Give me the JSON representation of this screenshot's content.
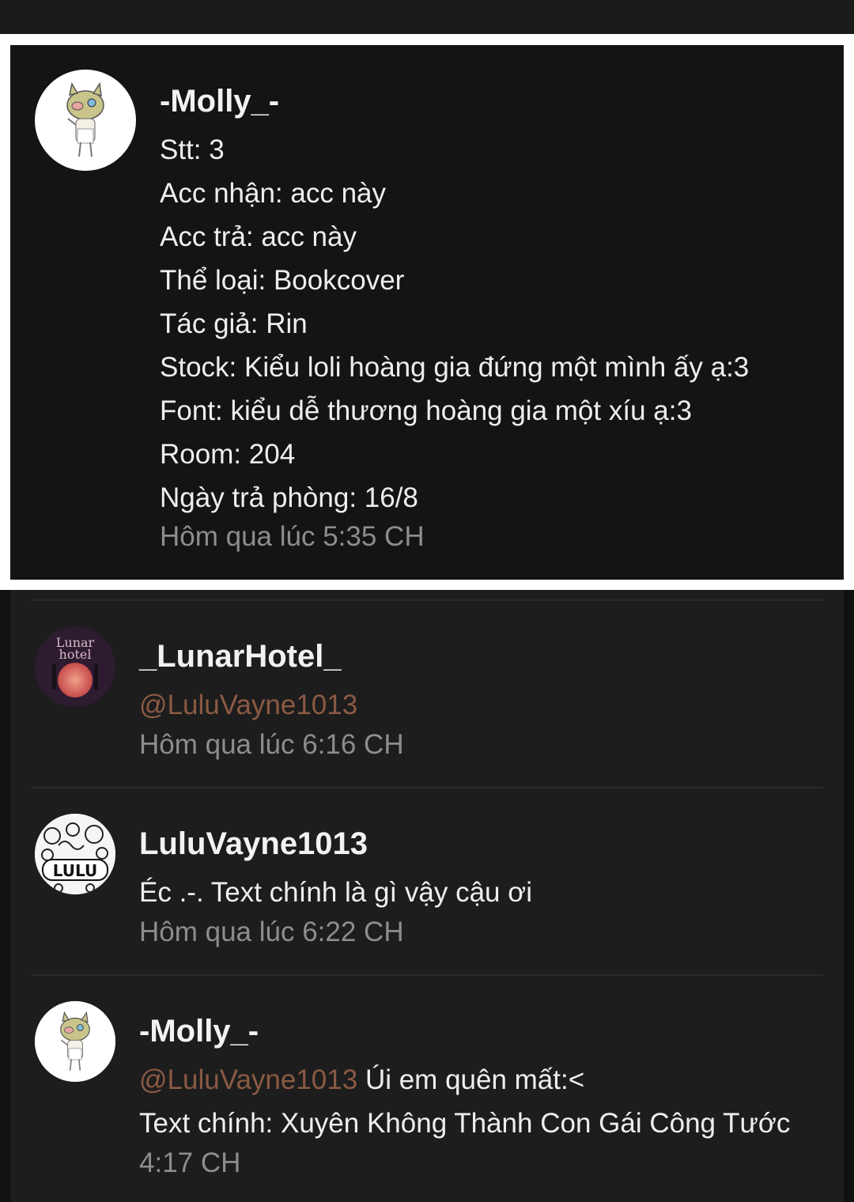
{
  "top_comment": {
    "avatar_icon": "boar-mask-character-avatar",
    "username": "-Molly_-",
    "lines": [
      "Stt: 3",
      "Acc nhận: acc này",
      "Acc trả: acc này",
      "Thể loại: Bookcover",
      "Tác giả: Rin",
      "Stock: Kiểu loli hoàng gia đứng một mình ấy ạ:3",
      "Font: kiểu dễ thương hoàng gia một xíu ạ:3",
      "Room: 204",
      "Ngày trả phòng: 16/8"
    ],
    "time": "Hôm qua lúc 5:35 CH"
  },
  "replies": [
    {
      "avatar_icon": "lunar-hotel-logo-avatar",
      "avatar_text_1": "Lunar",
      "avatar_text_2": "hotel",
      "username": "_LunarHotel_",
      "mention": "@LuluVayne1013",
      "text": "",
      "time": "Hôm qua lúc 6:16 CH"
    },
    {
      "avatar_icon": "lulu-doodle-avatar",
      "avatar_text": "LULU",
      "username": "LuluVayne1013",
      "mention": "",
      "text": "Éc .-. Text chính là gì vậy cậu ơi",
      "time": "Hôm qua lúc 6:22 CH"
    },
    {
      "avatar_icon": "boar-mask-character-avatar",
      "username": "-Molly_-",
      "mention": "@LuluVayne1013",
      "text": " Úi em quên mất:<",
      "text2": "Text chính: Xuyên Không Thành Con Gái Công Tước",
      "time": "4:17 CH"
    }
  ],
  "colors": {
    "background": "#141414",
    "mention": "#8a5a44",
    "timestamp": "#8d8d8d",
    "text": "#eeeeee"
  }
}
